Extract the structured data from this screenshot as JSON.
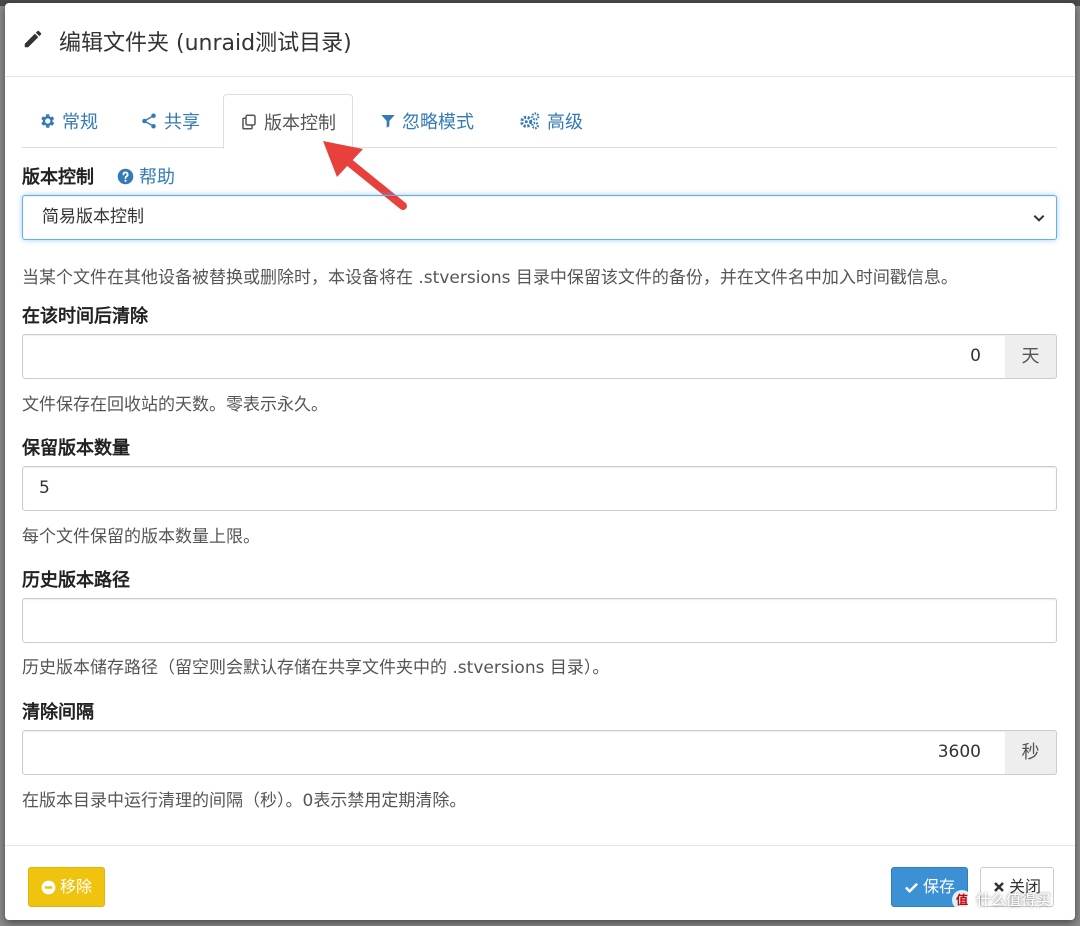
{
  "dialog": {
    "title": "编辑文件夹 (unraid测试目录)"
  },
  "tabs": [
    {
      "label": "常规",
      "icon": "gear-icon"
    },
    {
      "label": "共享",
      "icon": "share-icon"
    },
    {
      "label": "版本控制",
      "icon": "copy-icon",
      "active": true
    },
    {
      "label": "忽略模式",
      "icon": "filter-icon"
    },
    {
      "label": "高级",
      "icon": "cogs-icon"
    }
  ],
  "versioning": {
    "label": "版本控制",
    "help": "帮助",
    "selected": "简易版本控制",
    "description": "当某个文件在其他设备被替换或删除时，本设备将在 .stversions 目录中保留该文件的备份，并在文件名中加入时间戳信息。"
  },
  "clean_after": {
    "label": "在该时间后清除",
    "value": "0",
    "unit": "天",
    "hint": "文件保存在回收站的天数。零表示永久。"
  },
  "keep_versions": {
    "label": "保留版本数量",
    "value": "5",
    "hint": "每个文件保留的版本数量上限。"
  },
  "versions_path": {
    "label": "历史版本路径",
    "value": "",
    "hint": "历史版本储存路径（留空则会默认存储在共享文件夹中的 .stversions 目录）。"
  },
  "cleanup_interval": {
    "label": "清除间隔",
    "value": "3600",
    "unit": "秒",
    "hint": "在版本目录中运行清理的间隔（秒）。0表示禁用定期清除。"
  },
  "footer": {
    "remove": "移除",
    "save": "保存",
    "close": "关闭"
  },
  "watermark": {
    "badge": "值",
    "text": "什么值得买"
  },
  "colors": {
    "link": "#337ab7",
    "save": "#3b91d4",
    "remove": "#f0c30f",
    "arrow": "#e8403a"
  }
}
